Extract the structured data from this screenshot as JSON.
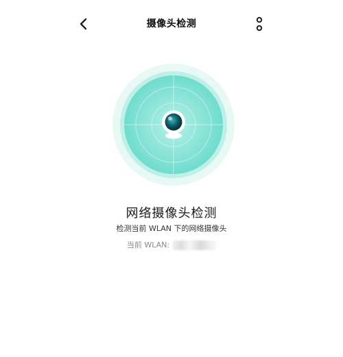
{
  "header": {
    "title": "摄像头检测",
    "back_icon": "chevron-left-icon",
    "more_icon": "more-vertical-icon"
  },
  "scan": {
    "icon": "camera-icon",
    "colors": {
      "outer": "#e6f8f5",
      "mid": "#c8f0ea",
      "inner": "#7fe0d3",
      "lens": "#0d5c66"
    }
  },
  "content": {
    "title": "网络摄像头检测",
    "subtitle": "检测当前 WLAN 下的网络摄像头",
    "wlan_label": "当前 WLAN:",
    "wlan_value": ""
  }
}
